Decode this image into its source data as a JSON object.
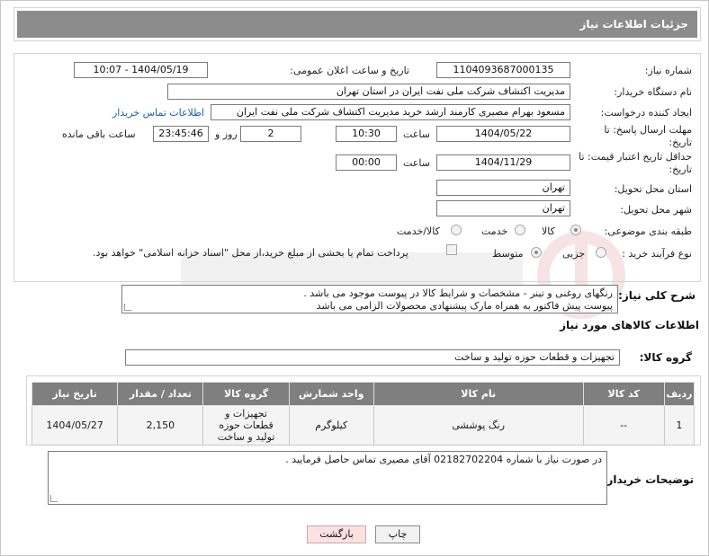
{
  "page": {
    "title": "جزئیات اطلاعات نیاز"
  },
  "form": {
    "need_number": {
      "label": "شماره نیاز:",
      "value": "1104093687000135"
    },
    "announce_datetime": {
      "label": "تاریخ و ساعت اعلان عمومی:",
      "value": "1404/05/19 - 10:07"
    },
    "buyer_org": {
      "label": "نام دستگاه خریدار:",
      "value": "مدیریت اکتشاف شرکت ملی نفت ایران در استان تهران"
    },
    "requester": {
      "label": "ایجاد کننده درخواست:",
      "value": "مسعود بهرام مصیری کارمند ارشد خرید مدیریت اکتشاف شرکت ملی نفت ایران",
      "contact_link": "اطلاعات تماس خریدار"
    },
    "reply_deadline": {
      "label": "مهلت ارسال پاسخ: تا تاریخ:",
      "date": "1404/05/22",
      "time_label": "ساعت",
      "time": "10:30",
      "days": "2",
      "days_label": "روز و",
      "remaining": "23:45:46",
      "remaining_label": "ساعت باقی مانده"
    },
    "price_validity": {
      "label": "حداقل تاریخ اعتبار قیمت: تا تاریخ:",
      "date": "1404/11/29",
      "time_label": "ساعت",
      "time": "00:00"
    },
    "delivery_province": {
      "label": "استان محل تحویل:",
      "value": "تهران"
    },
    "delivery_city": {
      "label": "شهر محل تحویل:",
      "value": "تهران"
    },
    "subject_class": {
      "label": "طبقه بندی موضوعی:",
      "options": [
        "کالا",
        "خدمت",
        "کالا/خدمت"
      ],
      "selected": "کالا"
    },
    "process_type": {
      "label": "نوع فرآیند خرید :",
      "options": [
        "جزیی",
        "متوسط"
      ],
      "selected": "متوسط",
      "payment_note": "پرداخت تمام یا بخشی از مبلغ خرید،از محل \"اسناد خزانه اسلامی\" خواهد بود."
    },
    "general_desc": {
      "label": "شرح کلی نیاز:",
      "line1": "رنگهای روغنی و تینر - مشخصات و شرایط کالا در پیوست موجود می باشد .",
      "line2": "پیوست پیش فاکتور به همراه مارک پیشنهادی محصولات الزامی می باشد"
    }
  },
  "goods": {
    "section_title": "اطلاعات کالاهای مورد نیاز",
    "group_label": "گروه کالا:",
    "group_value": "تجهیزات و قطعات حوزه تولید و ساخت",
    "columns": [
      "ردیف",
      "کد کالا",
      "نام کالا",
      "واحد شمارش",
      "گروه کالا",
      "تعداد / مقدار",
      "تاریخ نیاز"
    ],
    "rows": [
      {
        "row": "1",
        "code": "--",
        "name": "رنگ پوششی",
        "unit": "کیلوگرم",
        "group": "تجهیزات و قطعات حوزه تولید و ساخت",
        "qty": "2,150",
        "date": "1404/05/27"
      }
    ]
  },
  "buyer_notes": {
    "label": "توضیحات خریدار:",
    "text": "در صورت نیاز با شماره 02182702204 آقای مصیری تماس حاصل فرمایید ."
  },
  "buttons": {
    "print": "چاپ",
    "back": "بازگشت"
  },
  "colors": {
    "header_bg": "#8c8c8c",
    "table_header_bg": "#7f7f7f",
    "link": "#1a5fb4",
    "back_button_bg": "#fde0e0"
  }
}
